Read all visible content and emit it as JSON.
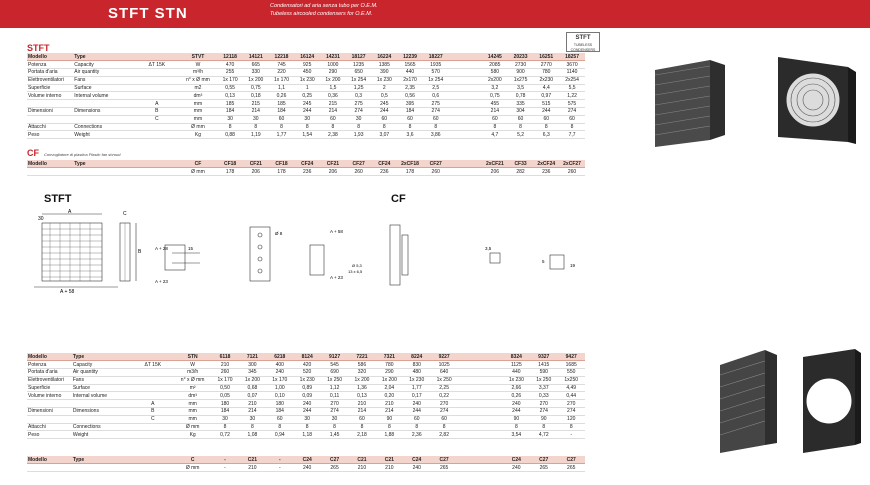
{
  "header": {
    "title": "STFT  STN",
    "sub1": "Condensatori ad aria senza tubo per O.E.M.",
    "sub2": "Tubeless aircooled condensers for O.E.M."
  },
  "logo": {
    "main": "STFT",
    "sub": "TUBELESS CONDENSERS"
  },
  "stft": {
    "section_title": "STFT",
    "head": [
      "Modello",
      "Type",
      "STVT",
      "12118",
      "14121",
      "12218",
      "16124",
      "14231",
      "18127",
      "16224",
      "12239",
      "18227",
      "",
      "14245",
      "20233",
      "16251",
      "18257"
    ],
    "rows": [
      [
        "Potenza",
        "Capacity",
        "ΔT 15K",
        "W",
        "470",
        "665",
        "745",
        "925",
        "1000",
        "1235",
        "1385",
        "1565",
        "1935",
        "",
        "2085",
        "2730",
        "2770",
        "3670"
      ],
      [
        "Portata d'aria",
        "Air quantity",
        "",
        "m³/h",
        "255",
        "330",
        "220",
        "450",
        "290",
        "650",
        "390",
        "440",
        "570",
        "",
        "580",
        "900",
        "780",
        "1140"
      ],
      [
        "Elettroventilatori",
        "Fans",
        "",
        "n° x Ø mm",
        "1x 170",
        "1x 200",
        "1x 170",
        "1x 230",
        "1x 200",
        "1x 254",
        "1x 230",
        "2x170",
        "1x 254",
        "",
        "2x200",
        "1x275",
        "2x230",
        "2x254"
      ],
      [
        "Superficie",
        "Surface",
        "",
        "m2",
        "0,55",
        "0,75",
        "1,1",
        "1",
        "1,5",
        "1,25",
        "2",
        "2,35",
        "2,5",
        "",
        "3,2",
        "3,5",
        "4,4",
        "5,5"
      ],
      [
        "Volume interno",
        "Internal volume",
        "",
        "dm³",
        "0,13",
        "0,18",
        "0,26",
        "0,25",
        "0,36",
        "0,3",
        "0,5",
        "0,56",
        "0,6",
        "",
        "0,75",
        "0,78",
        "0,97",
        "1,22"
      ],
      [
        "",
        "",
        "A",
        "mm",
        "185",
        "215",
        "185",
        "245",
        "215",
        "275",
        "245",
        "395",
        "275",
        "",
        "455",
        "335",
        "515",
        "575"
      ],
      [
        "Dimensioni",
        "Dimensions",
        "B",
        "mm",
        "184",
        "214",
        "184",
        "244",
        "214",
        "274",
        "244",
        "184",
        "274",
        "",
        "214",
        "304",
        "244",
        "274"
      ],
      [
        "",
        "",
        "C",
        "mm",
        "30",
        "30",
        "60",
        "30",
        "60",
        "30",
        "60",
        "60",
        "60",
        "",
        "60",
        "60",
        "60",
        "60"
      ],
      [
        "Attacchi",
        "Connections",
        "",
        "Ø mm",
        "8",
        "8",
        "8",
        "8",
        "8",
        "8",
        "8",
        "8",
        "8",
        "",
        "8",
        "8",
        "8",
        "8"
      ],
      [
        "Peso",
        "Weight",
        "",
        "Kg",
        "0,88",
        "1,19",
        "1,77",
        "1,54",
        "2,38",
        "1,93",
        "3,07",
        "3,6",
        "3,86",
        "",
        "4,7",
        "5,2",
        "6,3",
        "7,7"
      ]
    ]
  },
  "cf": {
    "section_title": "CF",
    "subtitle": "Convogliatore di plastica   Plastic fan shroud",
    "head": [
      "Modello",
      "Type",
      "",
      "CF",
      "CF18",
      "CF21",
      "CF18",
      "CF24",
      "CF21",
      "CF27",
      "CF24",
      "2xCF18",
      "CF27",
      "",
      "2xCF21",
      "CF33",
      "2xCF24",
      "2xCF27"
    ],
    "row": [
      "",
      "",
      "",
      "Ø mm",
      "178",
      "206",
      "178",
      "236",
      "206",
      "260",
      "236",
      "178",
      "260",
      "",
      "206",
      "282",
      "236",
      "260"
    ]
  },
  "stn": {
    "head": [
      "Modello",
      "Type",
      "",
      "STN",
      "6118",
      "7121",
      "6218",
      "8124",
      "9127",
      "7221",
      "7321",
      "8224",
      "9227",
      "",
      "8324",
      "9327",
      "9427"
    ],
    "rows": [
      [
        "Potenza",
        "Capacity",
        "ΔT 15K",
        "W",
        "210",
        "300",
        "400",
        "420",
        "545",
        "586",
        "780",
        "830",
        "1025",
        "",
        "1125",
        "1415",
        "1685"
      ],
      [
        "Portata d'aria",
        "Air quantity",
        "",
        "m3/h",
        "260",
        "345",
        "240",
        "520",
        "690",
        "320",
        "290",
        "480",
        "640",
        "",
        "440",
        "590",
        "550"
      ],
      [
        "Elettroventilatori",
        "Fans",
        "",
        "n° x Ø mm",
        "1x 170",
        "1x 200",
        "1x 170",
        "1x 230",
        "1x 250",
        "1x 200",
        "1x 200",
        "1x 230",
        "1x 250",
        "",
        "1x 230",
        "1x 250",
        "1x250"
      ],
      [
        "Superficie",
        "Surface",
        "",
        "m²",
        "0,50",
        "0,68",
        "1,00",
        "0,89",
        "1,12",
        "1,36",
        "2,04",
        "1,77",
        "2,25",
        "",
        "2,66",
        "3,37",
        "4,49"
      ],
      [
        "Volume interno",
        "Internal volume",
        "",
        "dm³",
        "0,05",
        "0,07",
        "0,10",
        "0,09",
        "0,11",
        "0,13",
        "0,20",
        "0,17",
        "0,22",
        "",
        "0,26",
        "0,33",
        "0,44"
      ],
      [
        "",
        "",
        "A",
        "mm",
        "180",
        "210",
        "180",
        "240",
        "270",
        "210",
        "210",
        "240",
        "270",
        "",
        "240",
        "270",
        "270"
      ],
      [
        "Dimensioni",
        "Dimensions",
        "B",
        "mm",
        "184",
        "214",
        "184",
        "244",
        "274",
        "214",
        "214",
        "244",
        "274",
        "",
        "244",
        "274",
        "274"
      ],
      [
        "",
        "",
        "C",
        "mm",
        "30",
        "30",
        "60",
        "30",
        "30",
        "60",
        "90",
        "60",
        "60",
        "",
        "90",
        "90",
        "120"
      ],
      [
        "Attacchi",
        "Connections",
        "",
        "Ø mm",
        "8",
        "8",
        "8",
        "8",
        "8",
        "8",
        "8",
        "8",
        "8",
        "",
        "8",
        "8",
        "8"
      ],
      [
        "Peso",
        "Weight",
        "",
        "Kg",
        "0,72",
        "1,08",
        "0,94",
        "1,18",
        "1,45",
        "2,18",
        "1,88",
        "2,36",
        "2,82",
        "",
        "3,54",
        "4,72",
        "-"
      ]
    ]
  },
  "cfstn": {
    "head": [
      "Modello",
      "Type",
      "",
      "C",
      "-",
      "C21",
      "-",
      "C24",
      "C27",
      "C21",
      "C21",
      "C24",
      "C27",
      "",
      "C24",
      "C27",
      "C27"
    ],
    "row": [
      "",
      "",
      "",
      "Ø mm",
      "-",
      "210",
      "-",
      "240",
      "265",
      "210",
      "210",
      "240",
      "265",
      "",
      "240",
      "265",
      "265"
    ]
  },
  "drawings": {
    "stft_label": "STFT",
    "cf_label": "CF",
    "a": "A",
    "b": "B",
    "c": "C",
    "d30": "30",
    "a58": "A + 58",
    "a28": "A + 28",
    "a23": "A + 23",
    "d15": "15",
    "d8": "Ø 8",
    "d10": "10",
    "d53": "Ø 5,3",
    "d13": "13 x 6,5",
    "d35": "3,5",
    "d5": "5",
    "d19": "19"
  },
  "colors": {
    "brand_red": "#c8252c",
    "header_row": "#f3d5cd"
  }
}
